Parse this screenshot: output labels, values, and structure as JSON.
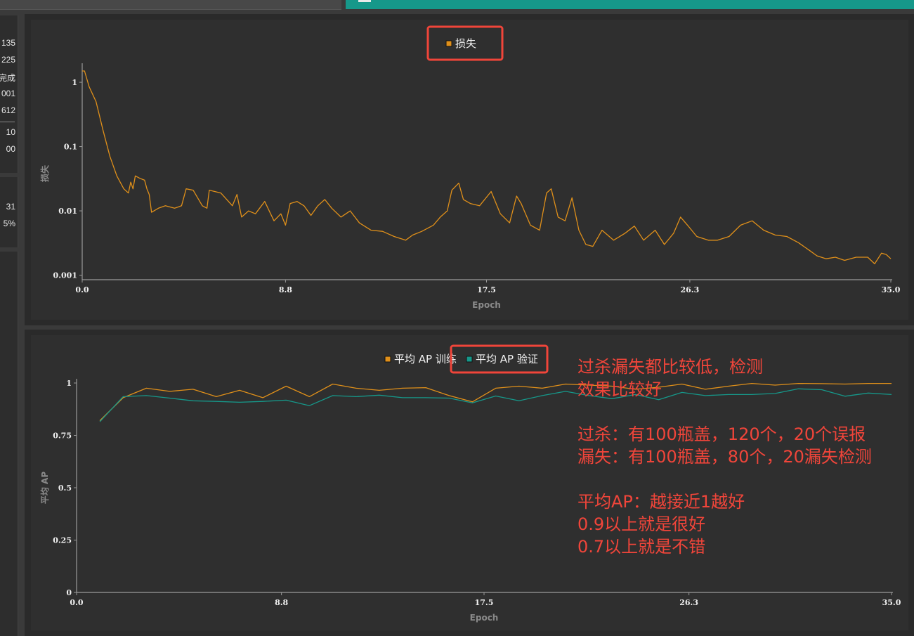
{
  "sidebar": {
    "group1": [
      "135",
      "225",
      "完成",
      "001",
      "612"
    ],
    "group2": [
      "10",
      "00"
    ],
    "group3": [
      "31",
      "5%"
    ]
  },
  "chart_data": [
    {
      "type": "line",
      "legend": [
        "损失"
      ],
      "xlabel": "Epoch",
      "ylabel": "损失",
      "yscale": "log",
      "xlim": [
        0,
        35
      ],
      "ylim": [
        0.00085,
        1.7
      ],
      "xticks": [
        "0.0",
        "8.8",
        "17.5",
        "26.3",
        "35.0"
      ],
      "yticks": [
        "0.001",
        "0.01",
        "0.1",
        "1"
      ],
      "legend_position": "top-center",
      "series": [
        {
          "name": "损失",
          "color": "#e0901a",
          "x": [
            0,
            0.1,
            0.3,
            0.6,
            0.9,
            1.2,
            1.5,
            1.8,
            2.0,
            2.1,
            2.2,
            2.3,
            2.5,
            2.7,
            2.8,
            2.9,
            3.0,
            3.3,
            3.6,
            4.0,
            4.3,
            4.5,
            4.8,
            5.2,
            5.4,
            5.5,
            6.0,
            6.5,
            6.7,
            6.9,
            7.2,
            7.5,
            7.9,
            8.3,
            8.6,
            8.8,
            9.0,
            9.3,
            9.6,
            9.9,
            10.2,
            10.5,
            10.8,
            11.2,
            11.6,
            12.0,
            12.5,
            13.0,
            13.5,
            14.0,
            14.3,
            14.7,
            15.2,
            15.5,
            15.8,
            16.0,
            16.3,
            16.5,
            16.8,
            17.2,
            17.7,
            18.1,
            18.5,
            18.8,
            19.0,
            19.4,
            19.8,
            20.1,
            20.3,
            20.6,
            20.9,
            21.2,
            21.5,
            21.8,
            22.1,
            22.5,
            23.0,
            23.5,
            23.9,
            24.3,
            24.8,
            25.2,
            25.6,
            25.9,
            26.2,
            26.6,
            27.1,
            27.5,
            28.0,
            28.5,
            29.0,
            29.5,
            30.0,
            30.5,
            31.0,
            31.5,
            31.8,
            32.2,
            32.6,
            33.0,
            33.5,
            34.0,
            34.3,
            34.6,
            34.8,
            35.0
          ],
          "y": [
            1.5,
            1.5,
            0.85,
            0.5,
            0.18,
            0.07,
            0.035,
            0.022,
            0.019,
            0.028,
            0.022,
            0.035,
            0.032,
            0.03,
            0.022,
            0.018,
            0.0095,
            0.011,
            0.012,
            0.011,
            0.012,
            0.022,
            0.021,
            0.012,
            0.011,
            0.021,
            0.019,
            0.012,
            0.018,
            0.008,
            0.01,
            0.009,
            0.014,
            0.007,
            0.009,
            0.006,
            0.013,
            0.014,
            0.012,
            0.0085,
            0.012,
            0.015,
            0.011,
            0.008,
            0.01,
            0.0065,
            0.005,
            0.0048,
            0.004,
            0.0035,
            0.0042,
            0.0048,
            0.006,
            0.008,
            0.01,
            0.021,
            0.027,
            0.015,
            0.013,
            0.012,
            0.02,
            0.009,
            0.0065,
            0.017,
            0.013,
            0.006,
            0.005,
            0.019,
            0.022,
            0.008,
            0.007,
            0.016,
            0.005,
            0.003,
            0.0028,
            0.005,
            0.0035,
            0.0045,
            0.0058,
            0.0035,
            0.005,
            0.003,
            0.0045,
            0.008,
            0.006,
            0.004,
            0.0035,
            0.0035,
            0.004,
            0.006,
            0.007,
            0.005,
            0.0042,
            0.004,
            0.0032,
            0.0024,
            0.002,
            0.0018,
            0.0019,
            0.0017,
            0.0019,
            0.0019,
            0.0015,
            0.0022,
            0.0021,
            0.0018
          ]
        }
      ]
    },
    {
      "type": "line",
      "legend": [
        "平均 AP 训练",
        "平均 AP 验证"
      ],
      "xlabel": "Epoch",
      "ylabel": "平均 AP",
      "xlim": [
        0,
        35
      ],
      "ylim": [
        0,
        1
      ],
      "xticks": [
        "0.0",
        "8.8",
        "17.5",
        "26.3",
        "35.0"
      ],
      "yticks": [
        "0",
        "0.25",
        "0.5",
        "0.75",
        "1"
      ],
      "legend_position": "top-center",
      "series": [
        {
          "name": "平均 AP 训练",
          "color": "#e0901a",
          "x": [
            1,
            2,
            3,
            4,
            5,
            6,
            7,
            8,
            9,
            10,
            11,
            12,
            13,
            14,
            15,
            16,
            17,
            18,
            19,
            20,
            21,
            22,
            23,
            24,
            25,
            26,
            27,
            28,
            29,
            30,
            31,
            32,
            33,
            34,
            35
          ],
          "y": [
            0.82,
            0.93,
            0.975,
            0.96,
            0.97,
            0.935,
            0.965,
            0.93,
            0.985,
            0.935,
            0.995,
            0.975,
            0.965,
            0.975,
            0.978,
            0.94,
            0.91,
            0.975,
            0.985,
            0.975,
            0.995,
            0.99,
            0.985,
            0.97,
            0.98,
            0.995,
            0.97,
            0.985,
            0.998,
            0.99,
            0.998,
            0.997,
            0.995,
            0.998,
            0.998
          ]
        },
        {
          "name": "平均 AP 验证",
          "color": "#16988a",
          "x": [
            1,
            2,
            3,
            4,
            5,
            6,
            7,
            8,
            9,
            10,
            11,
            12,
            13,
            14,
            15,
            16,
            17,
            18,
            19,
            20,
            21,
            22,
            23,
            24,
            25,
            26,
            27,
            28,
            29,
            30,
            31,
            32,
            33,
            34,
            35
          ],
          "y": [
            0.815,
            0.935,
            0.94,
            0.928,
            0.915,
            0.912,
            0.908,
            0.912,
            0.918,
            0.892,
            0.94,
            0.935,
            0.942,
            0.93,
            0.93,
            0.928,
            0.905,
            0.938,
            0.915,
            0.94,
            0.96,
            0.94,
            0.925,
            0.945,
            0.92,
            0.955,
            0.94,
            0.945,
            0.945,
            0.95,
            0.972,
            0.968,
            0.937,
            0.952,
            0.945
          ]
        }
      ]
    }
  ],
  "annotations": {
    "color": "#f0453a",
    "lines": [
      "过杀漏失都比较低，检测",
      "效果比较好",
      "",
      "过杀：有100瓶盖，120个，20个误报",
      "漏失：有100瓶盖，80个，20漏失检测",
      "",
      "平均AP：越接近1越好",
      "0.9以上就是很好",
      "0.7以上就是不错"
    ]
  }
}
